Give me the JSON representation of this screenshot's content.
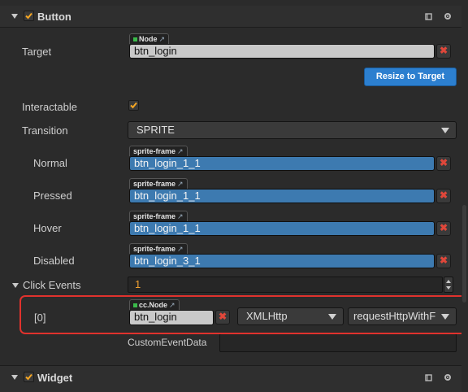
{
  "button_component": {
    "title": "Button",
    "enabled": true,
    "target": {
      "label": "Target",
      "tag": "Node",
      "value": "btn_login"
    },
    "resize_button": "Resize to Target",
    "interactable": {
      "label": "Interactable",
      "checked": true
    },
    "transition": {
      "label": "Transition",
      "value": "SPRITE"
    },
    "states": [
      {
        "label": "Normal",
        "tag": "sprite-frame",
        "value": "btn_login_1_1"
      },
      {
        "label": "Pressed",
        "tag": "sprite-frame",
        "value": "btn_login_1_1"
      },
      {
        "label": "Hover",
        "tag": "sprite-frame",
        "value": "btn_login_1_1"
      },
      {
        "label": "Disabled",
        "tag": "sprite-frame",
        "value": "btn_login_3_1"
      }
    ],
    "click_events": {
      "label": "Click Events",
      "count": "1",
      "items": [
        {
          "index": "[0]",
          "tag": "cc.Node",
          "node": "btn_login",
          "component": "XMLHttp",
          "handler": "requestHttpWithF",
          "custom_label": "CustomEventData",
          "custom_value": ""
        }
      ]
    }
  },
  "widget_component": {
    "title": "Widget",
    "enabled": true
  },
  "icons": {
    "book": "book-icon",
    "gear": "gear-icon",
    "link": "external-link-icon",
    "clear": "clear-x-icon"
  },
  "colors": {
    "highlight": "#e0322d",
    "accent_blue": "#2c7fcf",
    "checkbox": "#f5a623",
    "sprite_field": "#3d7ab0"
  }
}
